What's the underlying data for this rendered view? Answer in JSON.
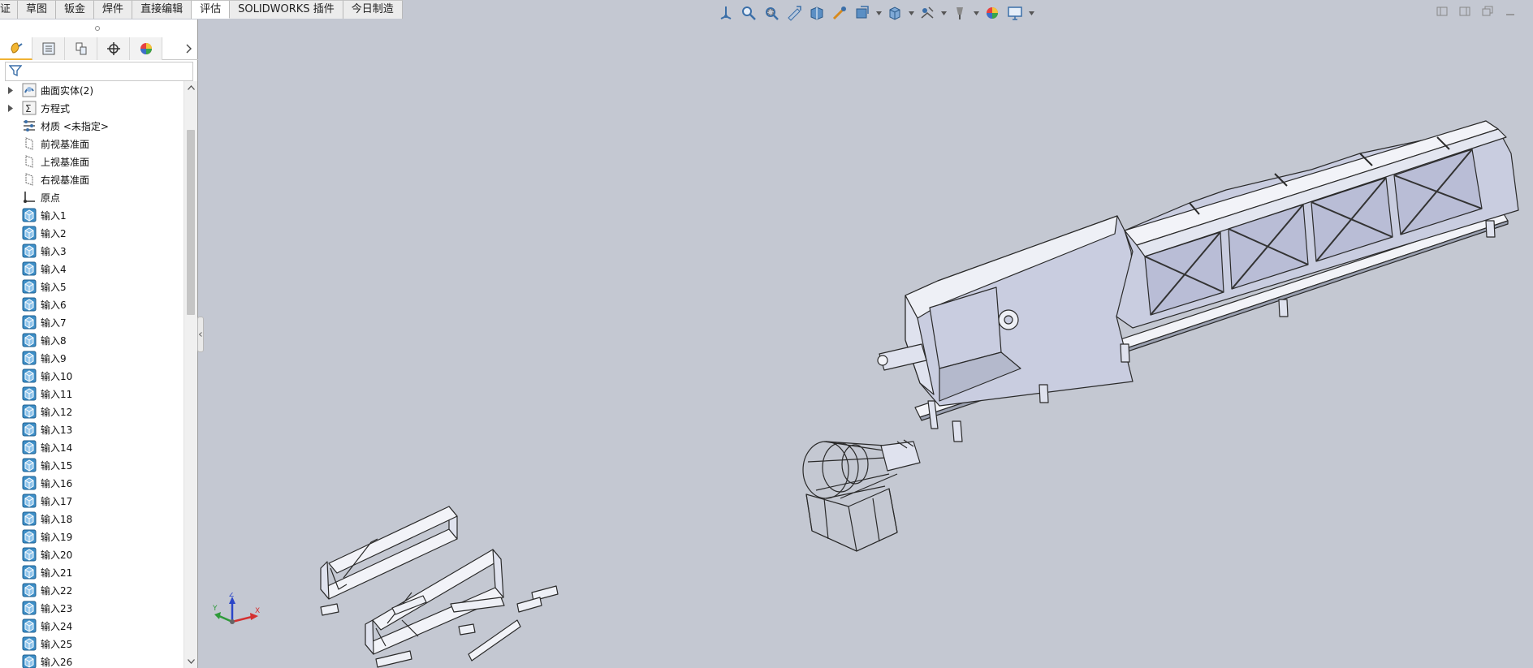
{
  "command_tabs": [
    {
      "label": "证",
      "active": false
    },
    {
      "label": "草图",
      "active": false
    },
    {
      "label": "钣金",
      "active": false
    },
    {
      "label": "焊件",
      "active": false
    },
    {
      "label": "直接编辑",
      "active": false
    },
    {
      "label": "评估",
      "active": true
    },
    {
      "label": "SOLIDWORKS 插件",
      "active": false
    },
    {
      "label": "今日制造",
      "active": false
    }
  ],
  "view_toolbar": {
    "icons": [
      "view-orientation-icon",
      "zoom-to-fit-icon",
      "zoom-to-area-icon",
      "previous-view-icon",
      "section-view-icon",
      "dynamic-annotation-icon",
      "view-settings-icon",
      "display-style-icon",
      "hide-show-items-icon",
      "edit-appearance-icon",
      "apply-scene-icon",
      "view-display-icon"
    ]
  },
  "window_controls": [
    "tile-left-icon",
    "tile-right-icon",
    "restore-icon",
    "minimize-icon"
  ],
  "feature_manager": {
    "tabs": [
      "feature-manager-tab-icon",
      "property-manager-tab-icon",
      "configuration-manager-tab-icon",
      "dimxpert-manager-tab-icon",
      "display-manager-tab-icon"
    ],
    "items": [
      {
        "label": "曲面实体(2)",
        "icon": "surface-bodies-icon",
        "expandable": true
      },
      {
        "label": "方程式",
        "icon": "equations-icon",
        "expandable": true
      },
      {
        "label": "材质 <未指定>",
        "icon": "material-icon",
        "expandable": false
      },
      {
        "label": "前视基准面",
        "icon": "plane-icon",
        "expandable": false
      },
      {
        "label": "上视基准面",
        "icon": "plane-icon",
        "expandable": false
      },
      {
        "label": "右视基准面",
        "icon": "plane-icon",
        "expandable": false
      },
      {
        "label": "原点",
        "icon": "origin-icon",
        "expandable": false
      },
      {
        "label": "输入1",
        "icon": "imported-body-icon",
        "expandable": false
      },
      {
        "label": "输入2",
        "icon": "imported-body-icon",
        "expandable": false
      },
      {
        "label": "输入3",
        "icon": "imported-body-icon",
        "expandable": false
      },
      {
        "label": "输入4",
        "icon": "imported-body-icon",
        "expandable": false
      },
      {
        "label": "输入5",
        "icon": "imported-body-icon",
        "expandable": false
      },
      {
        "label": "输入6",
        "icon": "imported-body-icon",
        "expandable": false
      },
      {
        "label": "输入7",
        "icon": "imported-body-icon",
        "expandable": false
      },
      {
        "label": "输入8",
        "icon": "imported-body-icon",
        "expandable": false
      },
      {
        "label": "输入9",
        "icon": "imported-body-icon",
        "expandable": false
      },
      {
        "label": "输入10",
        "icon": "imported-body-icon",
        "expandable": false
      },
      {
        "label": "输入11",
        "icon": "imported-body-icon",
        "expandable": false
      },
      {
        "label": "输入12",
        "icon": "imported-body-icon",
        "expandable": false
      },
      {
        "label": "输入13",
        "icon": "imported-body-icon",
        "expandable": false
      },
      {
        "label": "输入14",
        "icon": "imported-body-icon",
        "expandable": false
      },
      {
        "label": "输入15",
        "icon": "imported-body-icon",
        "expandable": false
      },
      {
        "label": "输入16",
        "icon": "imported-body-icon",
        "expandable": false
      },
      {
        "label": "输入17",
        "icon": "imported-body-icon",
        "expandable": false
      },
      {
        "label": "输入18",
        "icon": "imported-body-icon",
        "expandable": false
      },
      {
        "label": "输入19",
        "icon": "imported-body-icon",
        "expandable": false
      },
      {
        "label": "输入20",
        "icon": "imported-body-icon",
        "expandable": false
      },
      {
        "label": "输入21",
        "icon": "imported-body-icon",
        "expandable": false
      },
      {
        "label": "输入22",
        "icon": "imported-body-icon",
        "expandable": false
      },
      {
        "label": "输入23",
        "icon": "imported-body-icon",
        "expandable": false
      },
      {
        "label": "输入24",
        "icon": "imported-body-icon",
        "expandable": false
      },
      {
        "label": "输入25",
        "icon": "imported-body-icon",
        "expandable": false
      },
      {
        "label": "输入26",
        "icon": "imported-body-icon",
        "expandable": false
      }
    ]
  },
  "triad": {
    "x": "X",
    "y": "Y",
    "z": "Z"
  },
  "colors": {
    "viewport_bg": "#c4c8d2",
    "model_fill": "#c9cde0",
    "model_stroke": "#2a2a2a",
    "active_tab_underline": "#f0b233",
    "imported_icon": "#3d8fc8"
  }
}
